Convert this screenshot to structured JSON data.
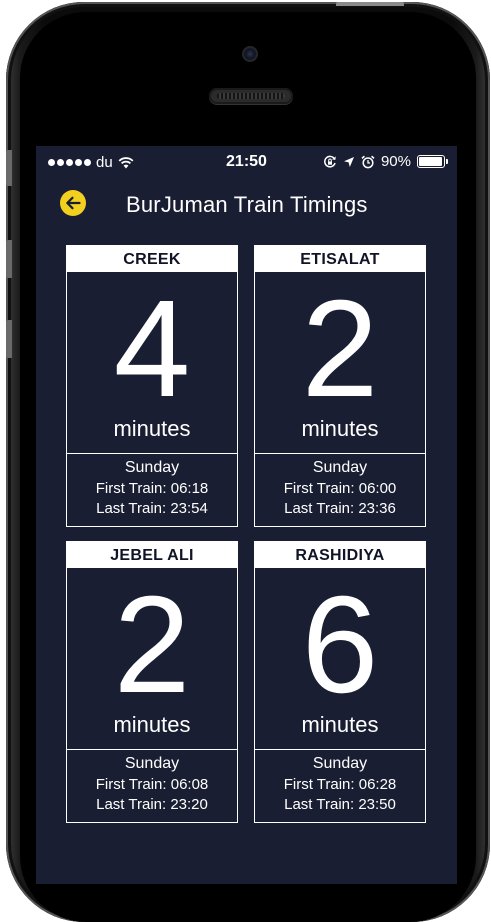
{
  "status_bar": {
    "carrier": "du",
    "time": "21:50",
    "battery": "90%",
    "icons": [
      "signal-dots-icon",
      "wifi-icon",
      "rotation-lock-icon",
      "location-arrow-icon",
      "alarm-icon",
      "battery-icon"
    ]
  },
  "nav": {
    "back_icon": "back-arrow-icon",
    "title": "BurJuman Train Timings",
    "accent_color": "#f2d01f"
  },
  "theme": {
    "background": "#191e33",
    "card_header_bg": "#ffffff",
    "text": "#ffffff"
  },
  "stations": [
    {
      "name": "CREEK",
      "minutes": "4",
      "unit": "minutes",
      "day": "Sunday",
      "first_train": "First Train: 06:18",
      "last_train": "Last Train: 23:54"
    },
    {
      "name": "ETISALAT",
      "minutes": "2",
      "unit": "minutes",
      "day": "Sunday",
      "first_train": "First Train: 06:00",
      "last_train": "Last Train: 23:36"
    },
    {
      "name": "JEBEL ALI",
      "minutes": "2",
      "unit": "minutes",
      "day": "Sunday",
      "first_train": "First Train: 06:08",
      "last_train": "Last Train: 23:20"
    },
    {
      "name": "RASHIDIYA",
      "minutes": "6",
      "unit": "minutes",
      "day": "Sunday",
      "first_train": "First Train: 06:28",
      "last_train": "Last Train: 23:50"
    }
  ]
}
